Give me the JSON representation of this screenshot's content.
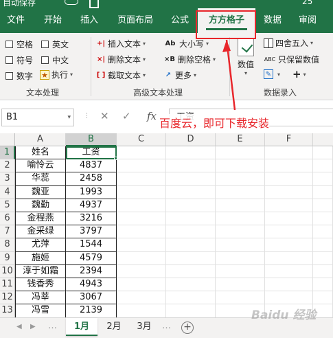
{
  "titlebar": {
    "autosave": "自动保存",
    "right_text": "25"
  },
  "tabs": [
    {
      "label": "文件"
    },
    {
      "label": "开始"
    },
    {
      "label": "插入"
    },
    {
      "label": "页面布局"
    },
    {
      "label": "公式"
    },
    {
      "label": "方方格子"
    },
    {
      "label": "数据"
    },
    {
      "label": "审阅"
    }
  ],
  "ribbon": {
    "text_processing": {
      "checkboxes": [
        "空格",
        "英文",
        "符号",
        "中文",
        "数字"
      ],
      "execute": "执行",
      "label": "文本处理"
    },
    "advanced_text": {
      "insert_text": "插入文本",
      "delete_text": "删除文本",
      "extract_text": "截取文本",
      "case": "大小写",
      "delete_spaces": "删除空格",
      "more": "更多",
      "label": "高级文本处理"
    },
    "numeric": {
      "value": "数值",
      "round": "四舍五入",
      "keep_value": "只保留数值",
      "label": "数据录入"
    }
  },
  "formula_bar": {
    "name_box": "B1",
    "formula_text": "工资"
  },
  "annotation": "百度云，即可下载安装",
  "columns": [
    "A",
    "B",
    "C",
    "D",
    "E",
    "F"
  ],
  "rows": [
    {
      "num": "1",
      "name": "姓名",
      "salary": "工资"
    },
    {
      "num": "2",
      "name": "喻怜云",
      "salary": "4837"
    },
    {
      "num": "3",
      "name": "华蕊",
      "salary": "2458"
    },
    {
      "num": "4",
      "name": "魏亚",
      "salary": "1993"
    },
    {
      "num": "5",
      "name": "魏勤",
      "salary": "4937"
    },
    {
      "num": "6",
      "name": "金程燕",
      "salary": "3216"
    },
    {
      "num": "7",
      "name": "金采绿",
      "salary": "3797"
    },
    {
      "num": "8",
      "name": "尤萍",
      "salary": "1544"
    },
    {
      "num": "9",
      "name": "施姬",
      "salary": "4579"
    },
    {
      "num": "10",
      "name": "淳于如霜",
      "salary": "2394"
    },
    {
      "num": "11",
      "name": "钱香秀",
      "salary": "4943"
    },
    {
      "num": "12",
      "name": "冯莘",
      "salary": "3067"
    },
    {
      "num": "13",
      "name": "冯雪",
      "salary": "2139"
    }
  ],
  "sheets": [
    "1月",
    "2月",
    "3月"
  ],
  "watermark": "Baidu 经验",
  "colors": {
    "accent": "#217346",
    "annotation": "#e8262b"
  }
}
